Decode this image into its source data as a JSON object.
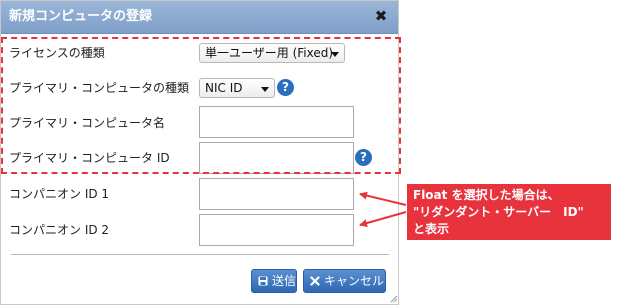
{
  "dialog": {
    "title": "新規コンピュータの登録",
    "close_glyph": "✖"
  },
  "form": {
    "license_type_label": "ライセンスの種類",
    "license_type_value": "単一ユーザー用 (Fixed)",
    "primary_type_label": "プライマリ・コンピュータの種類",
    "primary_type_value": "NIC ID",
    "primary_name_label": "プライマリ・コンピュータ名",
    "primary_name_value": "",
    "primary_id_label": "プライマリ・コンピュータ ID",
    "primary_id_value": "",
    "companion1_label": "コンパニオン ID 1",
    "companion1_value": "",
    "companion2_label": "コンパニオン ID 2",
    "companion2_value": "",
    "help_glyph": "?"
  },
  "buttons": {
    "submit_label": "送信",
    "cancel_label": "キャンセル"
  },
  "annotation": {
    "line1": "Float を選択した場合は、",
    "line2": "\"リダンダント・サーバー　ID\"",
    "line3": "と表示"
  },
  "colors": {
    "titlebar": "#8aa8d0",
    "highlight": "#e8333d",
    "button": "#3a74c0",
    "help_icon": "#2a6ebd"
  },
  "icons": {
    "close": "close-icon",
    "help": "question-icon",
    "submit": "floppy-disk-icon",
    "cancel": "x-icon",
    "resize": "resize-grip-icon"
  }
}
